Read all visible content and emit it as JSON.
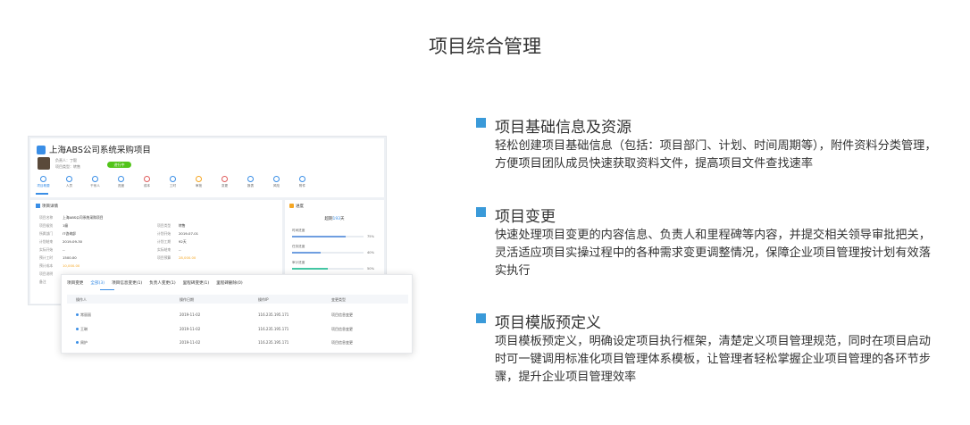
{
  "page": {
    "title": "项目综合管理"
  },
  "screenshot": {
    "project_title": "上海ABS公司系统采购项目",
    "owner_line": "负责人：丁毅",
    "type_line": "项目类型：转售",
    "status": "进行中",
    "nav": [
      "项目概要",
      "人员",
      "干系人",
      "进度",
      "成本",
      "工时",
      "审批",
      "变更",
      "报表",
      "风险",
      "附件"
    ],
    "detail": {
      "title": "项目详情",
      "rows": [
        {
          "label": "项目名称",
          "value": "上海ABS公司系统采购项目"
        },
        {
          "label": "项目级别",
          "value": "1级",
          "label2": "项目类型",
          "value2": "转售"
        },
        {
          "label": "所属部门",
          "value": "IT咨询部",
          "label2": "计划开始",
          "value2": "2019-07-01"
        },
        {
          "label": "计划结束",
          "value": "2019-09-30",
          "label2": "计划工期",
          "value2": "92天"
        },
        {
          "label": "实际开始",
          "value": "--",
          "label2": "实际结束",
          "value2": "--"
        },
        {
          "label": "预计工时",
          "value": "1500.00",
          "label2": "项目预算",
          "value2": "28,000.00"
        },
        {
          "label": "预计成本",
          "value": "10,000.00"
        },
        {
          "label": "项目说明",
          "value": ""
        },
        {
          "label": "备注",
          "value": ""
        }
      ]
    },
    "progress": {
      "title": "进度",
      "overdue_prefix": "超期",
      "overdue_days": "193",
      "overdue_suffix": "天",
      "bars": [
        {
          "label": "时间进度",
          "pct": 75,
          "pct_text": "75%",
          "color": "#6f9ee0"
        },
        {
          "label": "任务进度",
          "pct": 40,
          "pct_text": "40%",
          "color": "#6f9ee0"
        },
        {
          "label": "审计进度",
          "pct": 50,
          "pct_text": "50%",
          "color": "#45c7a4"
        }
      ]
    },
    "changes": {
      "tabs": [
        "项目变更",
        "全部(3)",
        "项目信息变更(1)",
        "负责人变更(1)",
        "里程碑变更(1)",
        "里程碑删除(0)"
      ],
      "columns": [
        "操作人",
        "操作日期",
        "操作IP",
        "变更类型"
      ],
      "rows": [
        [
          "常丽丽",
          "2019-11-02",
          "116.235.195.171",
          "项目信息变更"
        ],
        [
          "王琳",
          "2019-11-02",
          "116.235.195.171",
          "项目信息变更"
        ],
        [
          "周护",
          "2019-11-02",
          "116.235.195.171",
          "项目信息变更"
        ]
      ]
    }
  },
  "features": [
    {
      "title": "项目基础信息及资源",
      "desc": "轻松创建项目基础信息（包括：项目部门、计划、时间周期等），附件资料分类管理，方便项目团队成员快速获取资料文件，提高项目文件查找速率"
    },
    {
      "title": "项目变更",
      "desc": "快速处理项目变更的内容信息、负责人和里程碑等内容，并提交相关领导审批把关，灵活适应项目实操过程中的各种需求变更调整情况，保障企业项目管理按计划有效落实执行"
    },
    {
      "title": "项目模版预定义",
      "desc": "项目模板预定义，明确设定项目执行框架，清楚定义项目管理规范，同时在项目启动时可一键调用标准化项目管理体系模板，让管理者轻松掌握企业项目管理的各环节步骤，提升企业项目管理效率"
    }
  ]
}
